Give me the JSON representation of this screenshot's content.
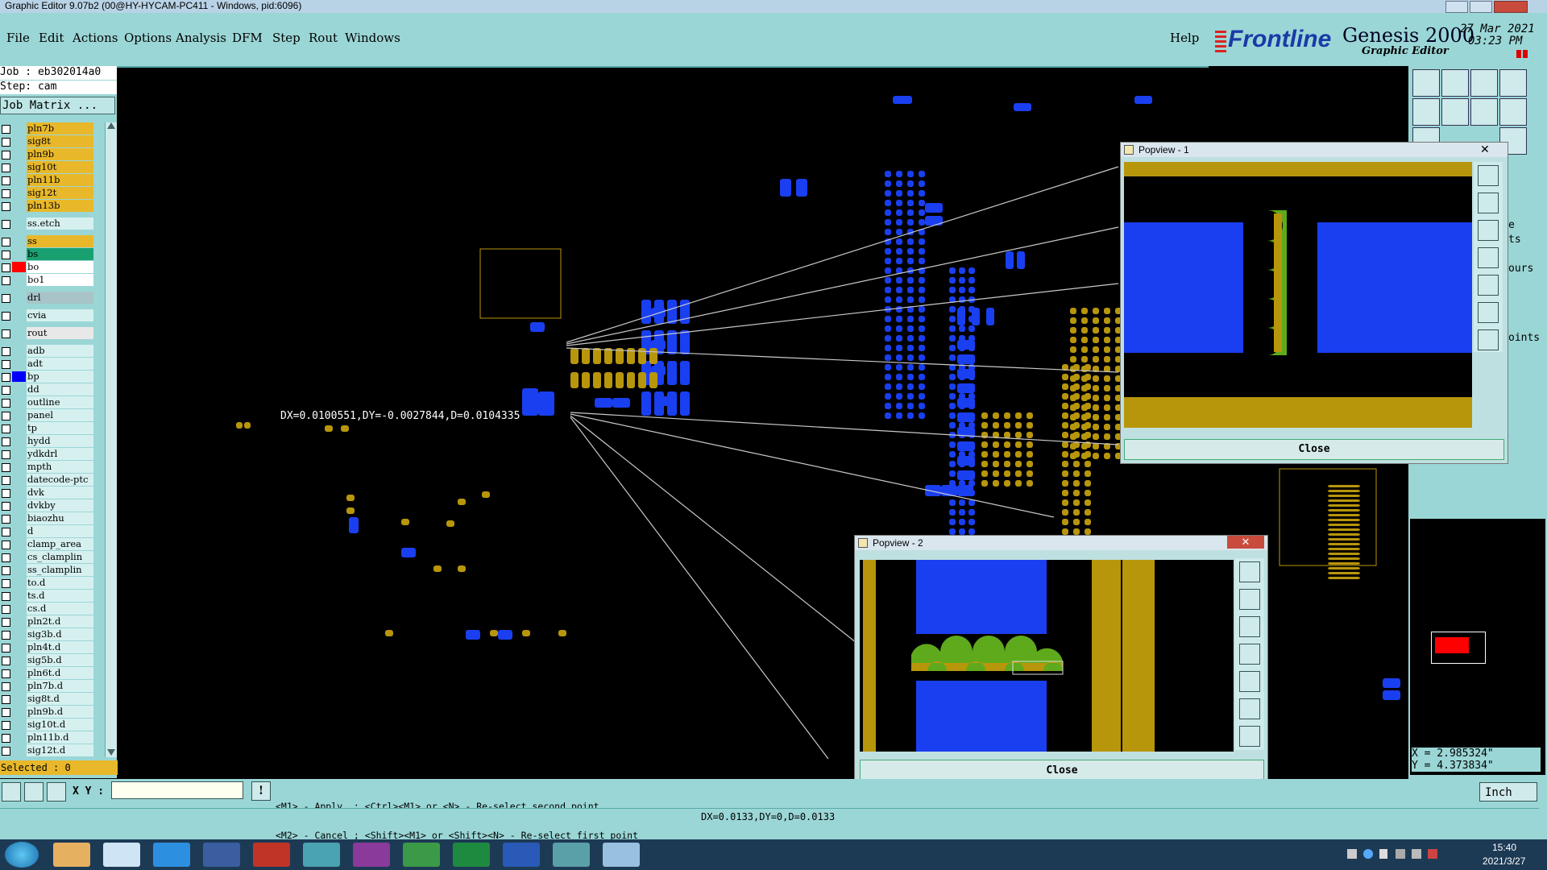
{
  "window": {
    "title": "Graphic Editor 9.07b2 (00@HY-HYCAM-PC411 - Windows, pid:6096)"
  },
  "menu": [
    "File",
    "Edit",
    "Actions",
    "Options",
    "Analysis",
    "DFM",
    "Step",
    "Rout",
    "Windows"
  ],
  "help_label": "Help",
  "brand": {
    "logo": "Frontline",
    "product": "Genesis 2000",
    "subtitle": "Graphic Editor",
    "date": "27 Mar 2021",
    "time": "03:23 PM"
  },
  "job": {
    "job_label": "Job : eb302014a0",
    "step_label": "Step: cam",
    "matrix_button": "Job Matrix ..."
  },
  "layers": [
    {
      "name": "pln7b",
      "color": "#e8b82a",
      "swatch": ""
    },
    {
      "name": "sig8t",
      "color": "#e8b82a",
      "swatch": ""
    },
    {
      "name": "pln9b",
      "color": "#e8b82a",
      "swatch": ""
    },
    {
      "name": "sig10t",
      "color": "#e8b82a",
      "swatch": ""
    },
    {
      "name": "pln11b",
      "color": "#e8b82a",
      "swatch": ""
    },
    {
      "name": "sig12t",
      "color": "#e8b82a",
      "swatch": ""
    },
    {
      "name": "pln13b",
      "color": "#e8b82a",
      "swatch": ""
    },
    {
      "name": "ss.etch",
      "color": "#d6f0f0",
      "swatch": ""
    },
    {
      "name": "ss",
      "color": "#e8b82a",
      "swatch": ""
    },
    {
      "name": "bs",
      "color": "#18a070",
      "swatch": ""
    },
    {
      "name": "bo",
      "color": "#ffffff",
      "swatch": "#ff0000"
    },
    {
      "name": "bo1",
      "color": "#ffffff",
      "swatch": ""
    },
    {
      "name": "drl",
      "color": "#a8c4c8",
      "swatch": ""
    },
    {
      "name": "cvia",
      "color": "#d6f0f0",
      "swatch": ""
    },
    {
      "name": "rout",
      "color": "#e8e8e8",
      "swatch": ""
    },
    {
      "name": "adb",
      "color": "#d6f0f0",
      "swatch": ""
    },
    {
      "name": "adt",
      "color": "#d6f0f0",
      "swatch": ""
    },
    {
      "name": "bp",
      "color": "#d6f0f0",
      "swatch": "#0000ff"
    },
    {
      "name": "dd",
      "color": "#d6f0f0",
      "swatch": ""
    },
    {
      "name": "outline",
      "color": "#d6f0f0",
      "swatch": ""
    },
    {
      "name": "panel",
      "color": "#d6f0f0",
      "swatch": ""
    },
    {
      "name": "tp",
      "color": "#d6f0f0",
      "swatch": ""
    },
    {
      "name": "hydd",
      "color": "#d6f0f0",
      "swatch": ""
    },
    {
      "name": "ydkdrl",
      "color": "#d6f0f0",
      "swatch": ""
    },
    {
      "name": "mpth",
      "color": "#d6f0f0",
      "swatch": ""
    },
    {
      "name": "datecode-ptc",
      "color": "#d6f0f0",
      "swatch": ""
    },
    {
      "name": "dvk",
      "color": "#d6f0f0",
      "swatch": ""
    },
    {
      "name": "dvkby",
      "color": "#d6f0f0",
      "swatch": ""
    },
    {
      "name": "biaozhu",
      "color": "#d6f0f0",
      "swatch": ""
    },
    {
      "name": "d",
      "color": "#d6f0f0",
      "swatch": ""
    },
    {
      "name": "clamp_area",
      "color": "#d6f0f0",
      "swatch": ""
    },
    {
      "name": "cs_clamplin",
      "color": "#d6f0f0",
      "swatch": ""
    },
    {
      "name": "ss_clamplin",
      "color": "#d6f0f0",
      "swatch": ""
    },
    {
      "name": "to.d",
      "color": "#d6f0f0",
      "swatch": ""
    },
    {
      "name": "ts.d",
      "color": "#d6f0f0",
      "swatch": ""
    },
    {
      "name": "cs.d",
      "color": "#d6f0f0",
      "swatch": ""
    },
    {
      "name": "pln2t.d",
      "color": "#d6f0f0",
      "swatch": ""
    },
    {
      "name": "sig3b.d",
      "color": "#d6f0f0",
      "swatch": ""
    },
    {
      "name": "pln4t.d",
      "color": "#d6f0f0",
      "swatch": ""
    },
    {
      "name": "sig5b.d",
      "color": "#d6f0f0",
      "swatch": ""
    },
    {
      "name": "pln6t.d",
      "color": "#d6f0f0",
      "swatch": ""
    },
    {
      "name": "pln7b.d",
      "color": "#d6f0f0",
      "swatch": ""
    },
    {
      "name": "sig8t.d",
      "color": "#d6f0f0",
      "swatch": ""
    },
    {
      "name": "pln9b.d",
      "color": "#d6f0f0",
      "swatch": ""
    },
    {
      "name": "sig10t.d",
      "color": "#d6f0f0",
      "swatch": ""
    },
    {
      "name": "pln11b.d",
      "color": "#d6f0f0",
      "swatch": ""
    },
    {
      "name": "sig12t.d",
      "color": "#d6f0f0",
      "swatch": ""
    }
  ],
  "selected_label": "Selected : 0",
  "measure_text": "DX=0.0100551,DY=-0.0027844,D=0.0104335",
  "popview1": {
    "title": "Popview - 1",
    "close_label": "Close"
  },
  "popview2": {
    "title": "Popview - 2",
    "close_label": "Close"
  },
  "side_labels": {
    "e": "e",
    "ts": "ts",
    "ours": "ours",
    "points": "oints"
  },
  "coords": {
    "x": "X = 2.985324\"",
    "y": "Y = 4.373834\""
  },
  "command": {
    "xy_label": "X Y :",
    "xy_value": "",
    "hint1": "<M1> - Apply  ; <Ctrl><M1> or <N> - Re-select second point",
    "hint2": "<M2> - Cancel ; <Shift><M1> or <Shift><N> - Re-select first point",
    "units": "Inch"
  },
  "status": "DX=0.0133,DY=0,D=0.0133",
  "taskbar": {
    "time": "15:40",
    "date": "2021/3/27"
  },
  "colors": {
    "panel": "#9bd6d6",
    "copper_blue": "#1a3ff0",
    "gold": "#b8960c",
    "green": "#5faa1c"
  }
}
